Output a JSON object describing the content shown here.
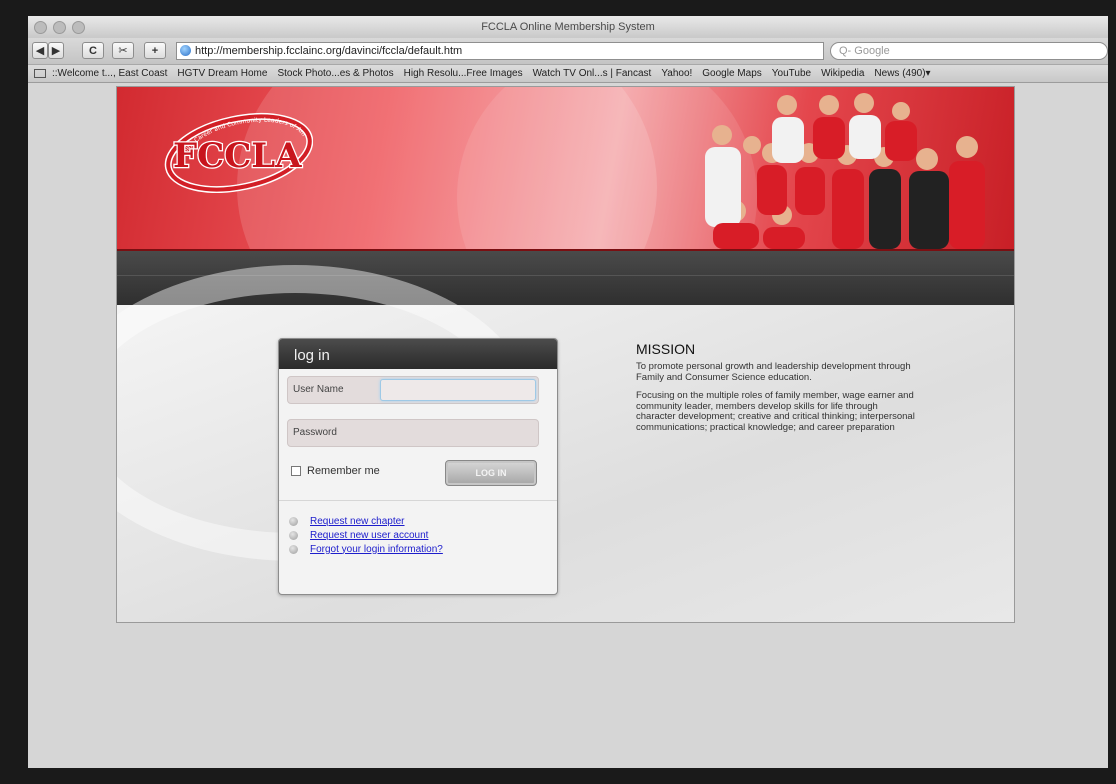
{
  "window": {
    "title": "FCCLA Online Membership System"
  },
  "toolbar": {
    "back": "◀",
    "forward": "▶",
    "reload": "C",
    "snip": "✂",
    "add": "+",
    "url": "http://membership.fcclainc.org/davinci/fccla/default.htm",
    "search_placeholder": "Q- Google"
  },
  "bookmarks": [
    "::Welcome t..., East Coast",
    "HGTV Dream Home",
    "Stock Photo...es & Photos",
    "High Resolu...Free Images",
    "Watch TV Onl...s | Fancast",
    "Yahoo!",
    "Google Maps",
    "YouTube",
    "Wikipedia",
    "News (490)▾"
  ],
  "banner": {
    "logo_text": "FCCLA",
    "logo_ring_text": "Family, Career and Community Leaders of America",
    "brand_red": "#d22a30"
  },
  "login": {
    "heading": "log in",
    "username_label": "User Name",
    "password_label": "Password",
    "remember_label": "Remember me",
    "button_label": "LOG IN",
    "links": [
      "Request new chapter",
      "Request new user account",
      "Forgot your login information?"
    ]
  },
  "mission": {
    "title": "MISSION",
    "paragraph1": "To promote personal growth and leadership development through Family and Consumer Science education.",
    "paragraph2": "Focusing on the multiple roles of family member, wage earner and community leader, members develop skills for life through character development; creative and critical thinking; interpersonal communications; practical knowledge; and career preparation"
  }
}
